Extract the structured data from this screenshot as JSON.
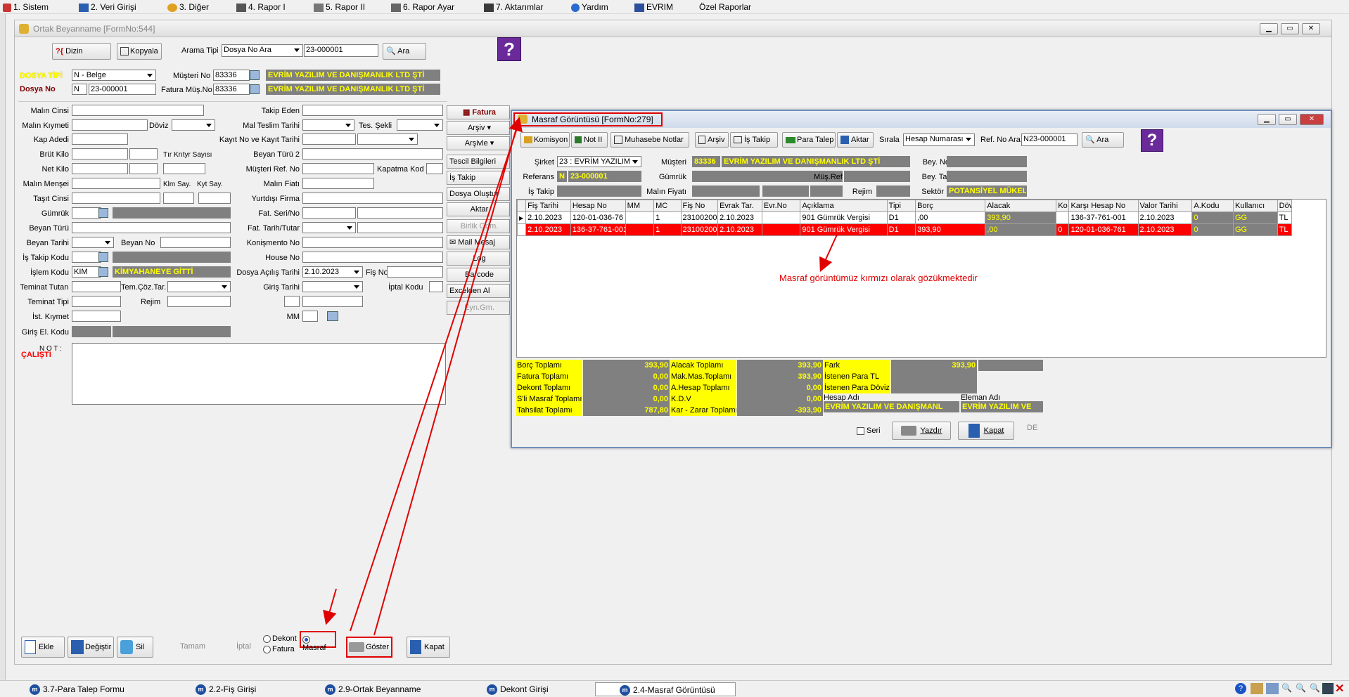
{
  "menu": [
    "1. Sistem",
    "2. Veri Girişi",
    "3. Diğer",
    "4. Rapor I",
    "5. Rapor II",
    "6. Rapor Ayar",
    "7. Aktarımlar",
    "Yardım",
    "EVRIM",
    "Özel Raporlar"
  ],
  "main": {
    "title": "Ortak Beyanname [FormNo:544]",
    "toolbar": {
      "dizin": "Dizin",
      "kopyala": "Kopyala",
      "arama_tipi_label": "Arama Tipi",
      "arama_tipi_value": "Dosya No Ara",
      "search_value": "23-000001",
      "ara": "Ara"
    },
    "header": {
      "dosya_tipi_label": "DOSYA TİPİ",
      "dosya_tipi_value": "N - Belge",
      "dosya_no_label": "Dosya No",
      "dosya_no_prefix": "N",
      "dosya_no_value": "23-000001",
      "musteri_no_label": "Müşteri No",
      "musteri_no_value": "83336",
      "fatura_mus_label": "Fatura Müş.No",
      "fatura_mus_value": "83336",
      "company": "EVRİM YAZILIM VE DANIŞMANLIK LTD ŞTİ"
    },
    "left_labels": {
      "malin_cinsi": "Malın Cinsi",
      "malin_kiymeti": "Malın Kıymeti",
      "doviz": "Döviz",
      "kap_adedi": "Kap Adedi",
      "brut_kilo": "Brüt Kilo",
      "tir": "Tır Krıtyr Sayısı",
      "net_kilo": "Net Kilo",
      "malin_mensei": "Malın Menşei",
      "klm_say": "Klm Say.",
      "kyt_say": "Kyt Say.",
      "tasit_cinsi": "Taşıt Cinsi",
      "gumruk": "Gümrük",
      "beyan_turu": "Beyan Türü",
      "beyan_tarihi": "Beyan Tarihi",
      "beyan_no": "Beyan No",
      "is_takip_kodu": "İş Takip Kodu",
      "islem_kodu": "İşlem Kodu",
      "teminat_tutari": "Teminat Tutarı",
      "tem_coz": "Tem.Çöz.Tar.",
      "teminat_tipi": "Teminat Tipi",
      "rejim": "Rejim",
      "ist_kymet": "İst. Kıymet",
      "giris_el_kodu": "Giriş El. Kodu",
      "not": "N O T :",
      "calisti": "ÇALIŞTI"
    },
    "islem_kodu_value": "KIM",
    "islem_kodu_desc": "KİMYAHANEYE GİTTİ",
    "mid_labels": {
      "takip_eden": "Takip Eden",
      "mal_teslim": "Mal Teslim Tarihi",
      "tes_sekli": "Tes. Şekli",
      "kayit": "Kayıt  No  ve Kayıt Tarihi",
      "beyan_turu2": "Beyan Türü 2",
      "musteri_ref": "Müşteri  Ref. No",
      "kapatma_kod": "Kapatma Kod",
      "malin_fiati": "Malın Fiatı",
      "yurtdisi": "Yurtdışı Firma",
      "fat_seri": "Fat. Seri/No",
      "fat_tarih": "Fat. Tarih/Tutar",
      "konismento": "Konişmento No",
      "house": "House No",
      "dosya_acilis": "Dosya Açılış Tarihi",
      "fis_no": "Fiş No",
      "giris_tarihi": "Giriş Tarihi",
      "iptal_kodu": "İptal Kodu",
      "mm": "MM"
    },
    "dosya_acilis_value": "2.10.2023",
    "side_buttons": [
      "Fatura",
      "Arşiv",
      "Arşivle",
      "Tescil Bilgileri",
      "İş Takip",
      "Dosya Oluştur",
      "Aktar",
      "Birlik Gdm.",
      "Mail Mesaj",
      "Log",
      "Barcode",
      "Excelden Al",
      "Eyn.Gm."
    ],
    "bottom": {
      "ekle": "Ekle",
      "degistir": "Değiştir",
      "sil": "Sil",
      "tamam": "Tamam",
      "iptal": "İptal",
      "dekont": "Dekont",
      "fatura": "Fatura",
      "masraf": "Masraf",
      "goster": "Göster",
      "kapat": "Kapat"
    }
  },
  "masraf": {
    "title": "Masraf Görüntüsü [FormNo:279]",
    "toolbar": {
      "komisyon": "Komisyon",
      "not": "Not II",
      "muhasebe": "Muhasebe Notlar",
      "arsiv": "Arşiv",
      "is_takip": "İş Takip",
      "para_talep": "Para Talep",
      "aktar": "Aktar",
      "sirala": "Sırala",
      "sirala_value": "Hesap Numarası",
      "ref_no": "Ref. No Ara",
      "ref_value": "N23-000001",
      "ara": "Ara"
    },
    "info": {
      "sirket_label": "Şirket",
      "sirket_value": "23 : EVRİM YAZILIM",
      "musteri_label": "Müşteri",
      "musteri_no": "83336",
      "musteri_name": "EVRİM YAZILIM VE DANIŞMANLIK LTD ŞTİ",
      "bey_no": "Bey. No",
      "referans_label": "Referans",
      "referans_prefix": "N",
      "referans_value": "23-000001",
      "gumruk": "Gümrük",
      "mus_ref": "Müş.Ref",
      "bey_tar": "Bey. Tar",
      "is_takip": "İş Takip",
      "malin_fiyati": "Malın Fiyatı",
      "rejim": "Rejim",
      "sektor": "Sektör",
      "sektor_value": "POTANSİYEL MÜKELL"
    },
    "columns": [
      "Fiş Tarihi",
      "Hesap No",
      "MM",
      "MC",
      "Fiş No",
      "Evrak Tar.",
      "Evr.No",
      "Açıklama",
      "Tipi",
      "Borç",
      "Alacak",
      "Ko",
      "Karşı Hesap No",
      "Valor Tarihi",
      "A.Kodu",
      "Kullanıcı",
      "Döv"
    ],
    "rows": [
      [
        "2.10.2023",
        "120-01-036-76",
        "",
        "1",
        "23100200",
        "2.10.2023",
        "",
        "901 Gümrük Vergisi",
        "D1",
        ",00",
        "393,90",
        "",
        "136-37-761-001",
        "2.10.2023",
        "0",
        "GG",
        "TL"
      ],
      [
        "2.10.2023",
        "136-37-761-001",
        "",
        "1",
        "23100200",
        "2.10.2023",
        "",
        "901 Gümrük Vergisi",
        "D1",
        "393,90",
        ",00",
        "0",
        "120-01-036-761",
        "2.10.2023",
        "0",
        "GG",
        "TL"
      ]
    ],
    "annotation": "Masraf görüntümüz kırmızı olarak gözükmektedir",
    "totals": {
      "borc_label": "Borç Toplamı",
      "borc": "393,90",
      "alacak_label": "Alacak Toplamı",
      "alacak": "393,90",
      "fark_label": "Fark",
      "fark": "393,90",
      "fatura_label": "Fatura Toplamı",
      "fatura": "0,00",
      "makmas_label": "Mak.Mas.Toplamı",
      "makmas": "393,90",
      "istenen_tl": "İstenen Para TL",
      "dekont_label": "Dekont Toplamı",
      "dekont": "0,00",
      "ahesap_label": "A.Hesap Toplamı",
      "ahesap": "0,00",
      "istenen_doviz": "İstenen Para Döviz",
      "sli_label": "S'li Masraf Toplamı",
      "sli": "0,00",
      "kdv_label": "K.D.V",
      "kdv": "0,00",
      "hesap_adi": "Hesap Adı",
      "eleman_adi": "Eleman Adı",
      "tahsilat_label": "Tahsilat Toplamı",
      "tahsilat": "787,80",
      "karzarar_label": "Kar - Zarar Toplamı",
      "karzarar": "-393,90",
      "hesap_adi_value": "EVRİM YAZILIM VE DANIŞMANL",
      "eleman_adi_value": "EVRİM YAZILIM VE"
    },
    "footer": {
      "seri": "Seri",
      "yazdir": "Yazdır",
      "kapat": "Kapat",
      "de": "DE"
    }
  },
  "taskbar": [
    "3.7-Para Talep Formu",
    "2.2-Fiş Girişi",
    "2.9-Ortak Beyanname",
    "Dekont Girişi",
    "2.4-Masraf Görüntüsü"
  ],
  "colors": {
    "highlight_red": "#ff0000",
    "yellow": "#ffff00",
    "gray": "#808080"
  }
}
